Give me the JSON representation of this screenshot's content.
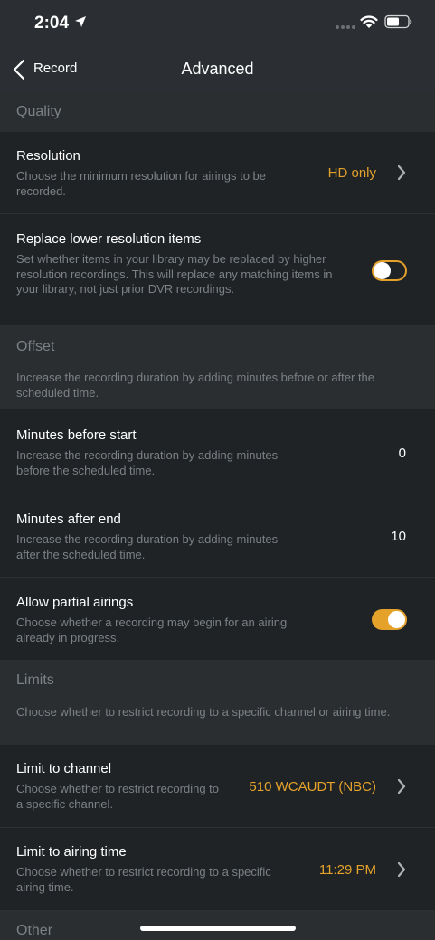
{
  "status_bar": {
    "time": "2:04"
  },
  "nav": {
    "back_label": "Record",
    "title": "Advanced"
  },
  "quality": {
    "header": "Quality",
    "resolution": {
      "title": "Resolution",
      "desc": "Choose the minimum resolution for airings to be recorded.",
      "value": "HD only"
    },
    "replace": {
      "title": "Replace lower resolution items",
      "desc": "Set whether items in your library may be replaced by higher resolution recordings. This will replace any matching items in your library, not just prior DVR recordings.",
      "enabled": false
    }
  },
  "offset": {
    "header": "Offset",
    "desc": "Increase the recording duration by adding minutes before or after the scheduled time.",
    "before": {
      "title": "Minutes before start",
      "desc": "Increase the recording duration by adding minutes before the scheduled time.",
      "value": "0"
    },
    "after": {
      "title": "Minutes after end",
      "desc": "Increase the recording duration by adding minutes after the scheduled time.",
      "value": "10"
    },
    "partial": {
      "title": "Allow partial airings",
      "desc": "Choose whether a recording may begin for an airing already in progress.",
      "enabled": true
    }
  },
  "limits": {
    "header": "Limits",
    "desc": "Choose whether to restrict recording to a specific channel or airing time.",
    "channel": {
      "title": "Limit to channel",
      "desc": "Choose whether to restrict recording to a specific channel.",
      "value": "510 WCAUDT (NBC)"
    },
    "airing_time": {
      "title": "Limit to airing time",
      "desc": "Choose whether to restrict recording to a specific airing time.",
      "value": "11:29 PM"
    }
  },
  "other": {
    "header": "Other"
  },
  "colors": {
    "accent": "#e5a22b",
    "background": "#1f2326",
    "section": "#2a2e31"
  },
  "icons": [
    "location-arrow-icon",
    "signal-icon",
    "wifi-icon",
    "battery-icon",
    "chevron-left-icon",
    "chevron-right-icon"
  ]
}
